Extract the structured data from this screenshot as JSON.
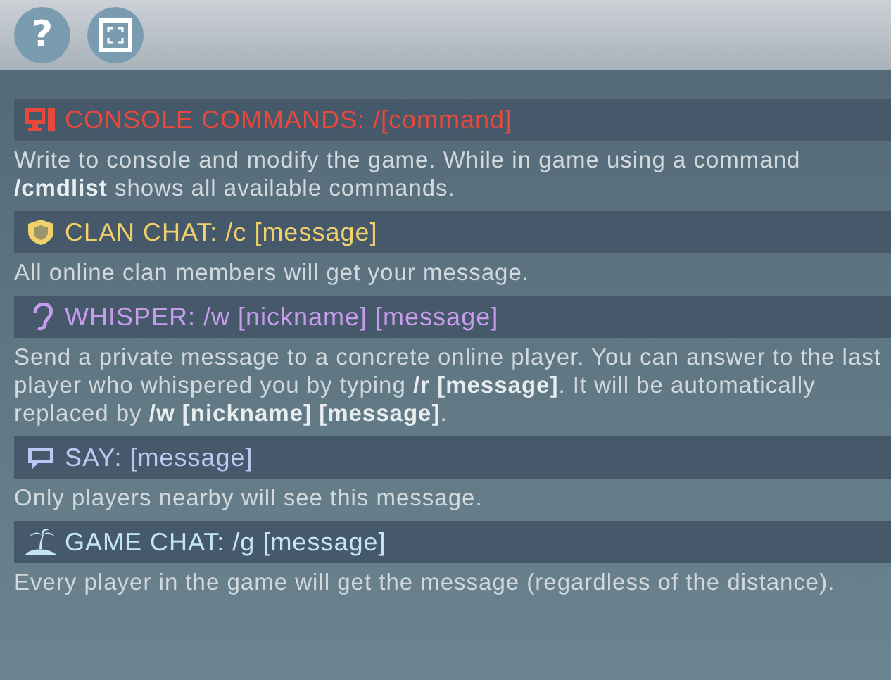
{
  "toolbar": {
    "help_label": "?"
  },
  "sections": [
    {
      "kind": "console",
      "color": "#e8493d",
      "title": "CONSOLE COMMANDS: /[command]",
      "description": "Write to console and modify the game. While in game using a command **/cmdlist** shows all available commands."
    },
    {
      "kind": "clan",
      "color": "#f2d06b",
      "title": "CLAN CHAT: /c [message]",
      "description": "All online clan members will get your message."
    },
    {
      "kind": "whisper",
      "color": "#c89cec",
      "title": "WHISPER: /w [nickname] [message]",
      "description": "Send a private message to a concrete online player. You can answer to the last player who whispered you by typing **/r [message]**. It will be automatically replaced by **/w [nickname] [message]**."
    },
    {
      "kind": "say",
      "color": "#bcc8f4",
      "title": "SAY: [message]",
      "description": "Only players nearby will see this message."
    },
    {
      "kind": "game",
      "color": "#c2e6f8",
      "title": "GAME CHAT: /g [message]",
      "description": "Every player in the game will get the message (regardless of the distance)."
    }
  ]
}
